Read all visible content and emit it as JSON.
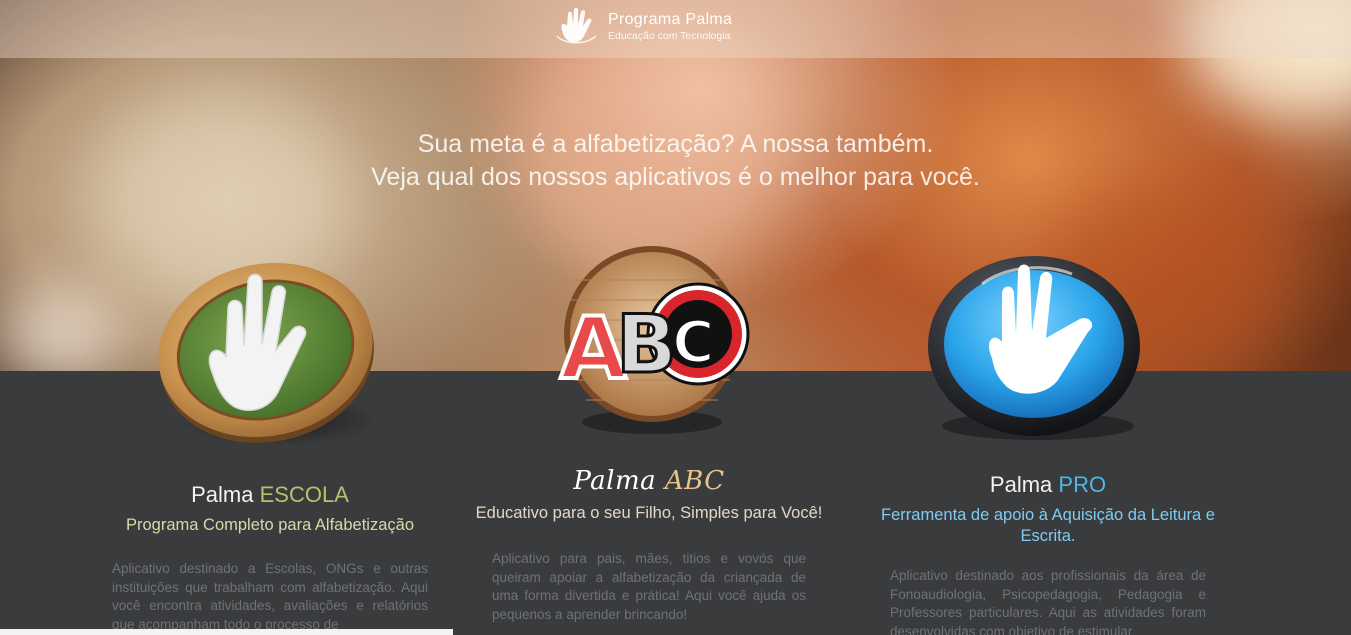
{
  "header": {
    "brand_title": "Programa Palma",
    "brand_subtitle": "Educação com Tecnologia"
  },
  "hero": {
    "headline_line1": "Sua meta é a alfabetização? A nossa também.",
    "headline_line2": "Veja qual dos nossos aplicativos é o melhor para você."
  },
  "products": [
    {
      "name_prefix": "Palma",
      "name_accent": "ESCOLA",
      "tagline": "Programa Completo para Alfabetização",
      "description": "Aplicativo destinado a Escolas, ONGs e outras instituições que trabalham com alfabetização. Aqui você encontra atividades, avaliações e relatórios que acompanham todo o processo de",
      "accent_color": "#b7c26a"
    },
    {
      "name_prefix": "Palma",
      "name_accent": "ABC",
      "tagline": "Educativo para o seu Filho, Simples para Você!",
      "description": "Aplicativo para pais, mães, titios e vovós que queiram apoiar a alfabetização da criançada de uma forma divertida e prática! Aqui você ajuda os pequenos a aprender brincando!",
      "accent_color": "#e7c48b"
    },
    {
      "name_prefix": "Palma",
      "name_accent": "PRO",
      "tagline": "Ferramenta de apoio à Aquisição da Leitura e Escrita.",
      "description": "Aplicativo destinado aos profissionais da área de Fonoaudiologia, Psicopedagogia, Pedagogia e Professores particulares. Aqui as atividades foram desenvolvidas com objetivo de estimular",
      "accent_color": "#4fb6ec"
    }
  ],
  "logo_abc_text": "ABC",
  "colors": {
    "dark_section": "#3a3b3d",
    "escola_green": "#5f8a3a",
    "pro_blue": "#2fa6ea"
  }
}
